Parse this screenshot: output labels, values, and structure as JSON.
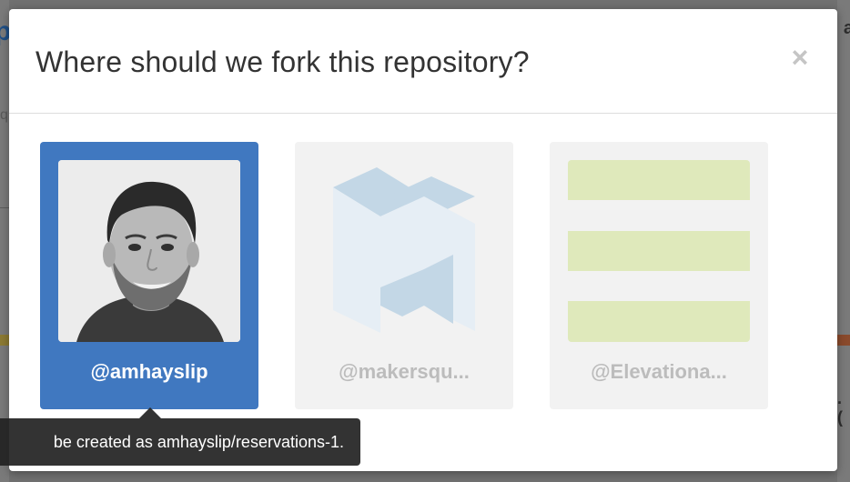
{
  "background": {
    "left_char": "p",
    "left_q": "q",
    "right_char": "a",
    "right_dot": ". ("
  },
  "modal": {
    "title": "Where should we fork this repository?",
    "close_label": "×"
  },
  "accounts": [
    {
      "handle": "@amhayslip",
      "selected": true,
      "avatar": "user-photo"
    },
    {
      "handle": "@makersqu...",
      "selected": false,
      "avatar": "makersquare-logo"
    },
    {
      "handle": "@Elevationa...",
      "selected": false,
      "avatar": "elevation-logo"
    }
  ],
  "tooltip": {
    "text": "be created as amhayslip/reservations-1."
  },
  "colors": {
    "selected": "#4078c0",
    "unselected": "#f2f2f2",
    "makersquare_logo": "#c3d7e6",
    "elevation_logo": "#dfe9bb"
  }
}
